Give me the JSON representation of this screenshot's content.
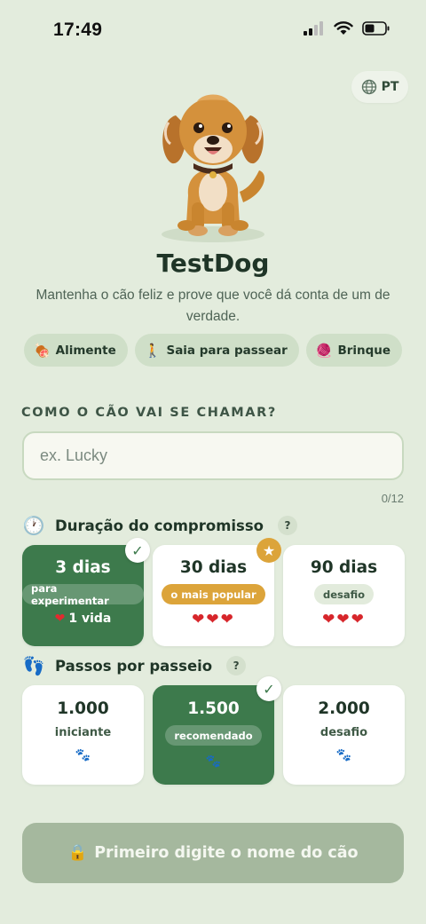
{
  "status_bar": {
    "time": "17:49"
  },
  "language": {
    "label": "PT",
    "icon": "globe-icon"
  },
  "app": {
    "title": "TestDog",
    "subtitle": "Mantenha o cão feliz e prove que você dá conta de um de verdade."
  },
  "chips": [
    {
      "icon": "🍖",
      "label": "Alimente"
    },
    {
      "icon": "🚶",
      "label": "Saia para passear"
    },
    {
      "icon": "🧶",
      "label": "Brinque"
    }
  ],
  "name_section": {
    "label": "COMO O CÃO VAI SE CHAMAR?",
    "placeholder": "ex. Lucky",
    "counter": "0/12"
  },
  "duration": {
    "heading": "Duração do compromisso",
    "icon": "🕐",
    "help": "?",
    "options": [
      {
        "title": "3 dias",
        "tag": "para experimentar",
        "lives": "1 vida",
        "selected": true
      },
      {
        "title": "30 dias",
        "tag": "o mais popular",
        "hearts": "❤❤❤",
        "badge": "★"
      },
      {
        "title": "90 dias",
        "tag": "desafio",
        "hearts": "❤❤❤"
      }
    ]
  },
  "steps": {
    "heading": "Passos por passeio",
    "icon": "👣",
    "help": "?",
    "options": [
      {
        "value": "1.000",
        "label": "iniciante"
      },
      {
        "value": "1.500",
        "label": "recomendado",
        "selected": true
      },
      {
        "value": "2.000",
        "label": "desafio"
      }
    ]
  },
  "cta": {
    "icon": "🔒",
    "label": "Primeiro digite o nome do cão"
  },
  "colors": {
    "accent": "#3d7a4c",
    "gold": "#dca43a",
    "background": "#e3ecdd",
    "disabled": "#a5b89e"
  }
}
